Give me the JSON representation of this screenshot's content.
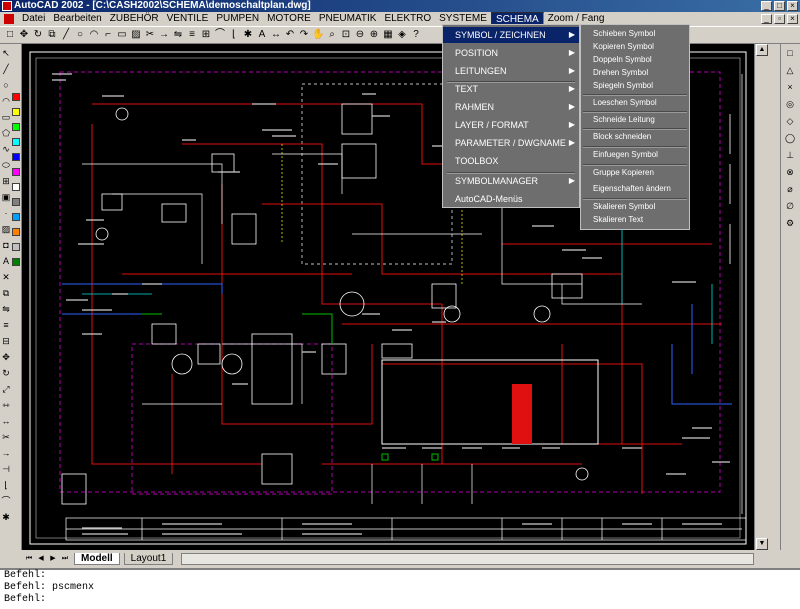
{
  "window": {
    "title": "AutoCAD 2002 - [C:\\CASH2002\\SCHEMA\\demoschaltplan.dwg]"
  },
  "menubar": {
    "items": [
      "Datei",
      "Bearbeiten",
      "ZUBEHÖR",
      "VENTILE",
      "PUMPEN",
      "MOTORE",
      "PNEUMATIK",
      "ELEKTRO",
      "SYSTEME",
      "SCHEMA",
      "Zoom / Fang"
    ]
  },
  "schema_menu": {
    "items": [
      {
        "label": "SYMBOL / ZEICHNEN"
      },
      {
        "label": "POSITION"
      },
      {
        "label": "LEITUNGEN"
      },
      {
        "label": "TEXT"
      },
      {
        "label": "RAHMEN"
      },
      {
        "label": "LAYER / FORMAT"
      },
      {
        "label": "PARAMETER / DWGNAME"
      },
      {
        "label": "TOOLBOX"
      },
      {
        "label": "SYMBOLMANAGER"
      },
      {
        "label": "AutoCAD-Menüs"
      }
    ]
  },
  "symbol_submenu": {
    "items": [
      "Schieben Symbol",
      "Kopieren Symbol",
      "Doppeln Symbol",
      "Drehen Symbol",
      "Spiegeln Symbol",
      "Loeschen Symbol",
      "Schneide Leitung",
      "Block schneiden",
      "Einfuegen Symbol",
      "Gruppe Kopieren",
      "Eigenschaften ändern",
      "Skalieren Symbol",
      "Skalieren Text"
    ]
  },
  "tabs": {
    "model": "Modell",
    "layout": "Layout1"
  },
  "command_line": {
    "lines": [
      "Befehl:",
      "Befehl: pscmenx",
      "Befehl:"
    ]
  },
  "colors": {
    "title_bar": "#0a246a",
    "canvas": "#000000",
    "menu_bg": "#6e6e6e",
    "highlight": "#0a246a"
  }
}
